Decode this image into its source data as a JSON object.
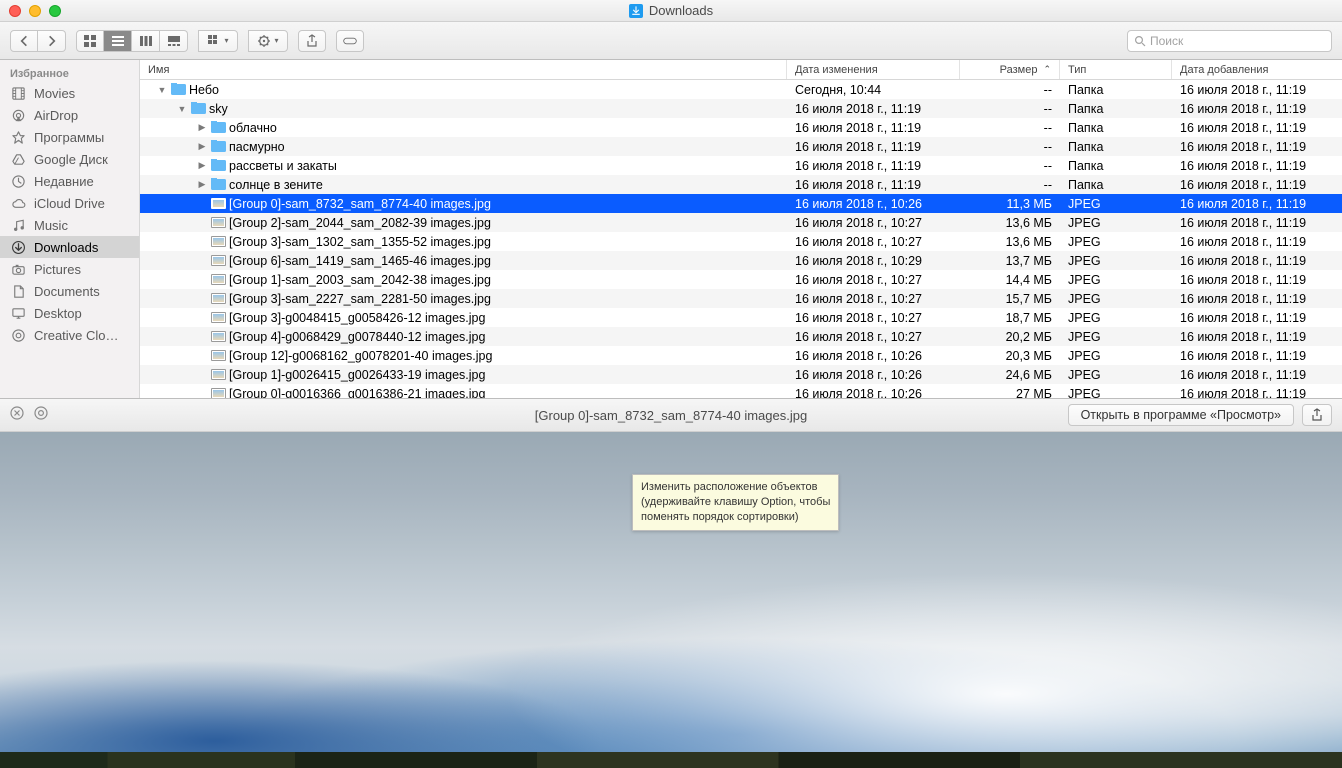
{
  "window": {
    "title": "Downloads"
  },
  "toolbar": {
    "search_placeholder": "Поиск"
  },
  "sidebar": {
    "header": "Избранное",
    "items": [
      {
        "label": "Movies",
        "icon": "film"
      },
      {
        "label": "AirDrop",
        "icon": "airdrop"
      },
      {
        "label": "Программы",
        "icon": "apps"
      },
      {
        "label": "Google Диск",
        "icon": "gdrive"
      },
      {
        "label": "Недавние",
        "icon": "clock"
      },
      {
        "label": "iCloud Drive",
        "icon": "cloud"
      },
      {
        "label": "Music",
        "icon": "music"
      },
      {
        "label": "Downloads",
        "icon": "download",
        "active": true
      },
      {
        "label": "Pictures",
        "icon": "camera"
      },
      {
        "label": "Documents",
        "icon": "doc"
      },
      {
        "label": "Desktop",
        "icon": "desktop"
      },
      {
        "label": "Creative Clo…",
        "icon": "cc"
      }
    ]
  },
  "columns": {
    "name": "Имя",
    "modified": "Дата изменения",
    "size": "Размер",
    "type": "Тип",
    "added": "Дата добавления"
  },
  "rows": [
    {
      "indent": 0,
      "disclosure": "down",
      "icon": "folder",
      "name": "Небо",
      "modified": "Сегодня, 10:44",
      "size": "--",
      "type": "Папка",
      "added": "16 июля 2018 г., 11:19"
    },
    {
      "indent": 1,
      "disclosure": "down",
      "icon": "folder",
      "name": "sky",
      "modified": "16 июля 2018 г., 11:19",
      "size": "--",
      "type": "Папка",
      "added": "16 июля 2018 г., 11:19"
    },
    {
      "indent": 2,
      "disclosure": "right",
      "icon": "folder",
      "name": "облачно",
      "modified": "16 июля 2018 г., 11:19",
      "size": "--",
      "type": "Папка",
      "added": "16 июля 2018 г., 11:19"
    },
    {
      "indent": 2,
      "disclosure": "right",
      "icon": "folder",
      "name": "пасмурно",
      "modified": "16 июля 2018 г., 11:19",
      "size": "--",
      "type": "Папка",
      "added": "16 июля 2018 г., 11:19"
    },
    {
      "indent": 2,
      "disclosure": "right",
      "icon": "folder",
      "name": "рассветы и закаты",
      "modified": "16 июля 2018 г., 11:19",
      "size": "--",
      "type": "Папка",
      "added": "16 июля 2018 г., 11:19"
    },
    {
      "indent": 2,
      "disclosure": "right",
      "icon": "folder",
      "name": "солнце в зените",
      "modified": "16 июля 2018 г., 11:19",
      "size": "--",
      "type": "Папка",
      "added": "16 июля 2018 г., 11:19"
    },
    {
      "indent": 2,
      "icon": "image",
      "name": "[Group 0]-sam_8732_sam_8774-40 images.jpg",
      "modified": "16 июля 2018 г., 10:26",
      "size": "11,3 МБ",
      "type": "JPEG",
      "added": "16 июля 2018 г., 11:19",
      "selected": true
    },
    {
      "indent": 2,
      "icon": "image",
      "name": "[Group 2]-sam_2044_sam_2082-39 images.jpg",
      "modified": "16 июля 2018 г., 10:27",
      "size": "13,6 МБ",
      "type": "JPEG",
      "added": "16 июля 2018 г., 11:19"
    },
    {
      "indent": 2,
      "icon": "image",
      "name": "[Group 3]-sam_1302_sam_1355-52 images.jpg",
      "modified": "16 июля 2018 г., 10:27",
      "size": "13,6 МБ",
      "type": "JPEG",
      "added": "16 июля 2018 г., 11:19"
    },
    {
      "indent": 2,
      "icon": "image",
      "name": "[Group 6]-sam_1419_sam_1465-46 images.jpg",
      "modified": "16 июля 2018 г., 10:29",
      "size": "13,7 МБ",
      "type": "JPEG",
      "added": "16 июля 2018 г., 11:19"
    },
    {
      "indent": 2,
      "icon": "image",
      "name": "[Group 1]-sam_2003_sam_2042-38 images.jpg",
      "modified": "16 июля 2018 г., 10:27",
      "size": "14,4 МБ",
      "type": "JPEG",
      "added": "16 июля 2018 г., 11:19"
    },
    {
      "indent": 2,
      "icon": "image",
      "name": "[Group 3]-sam_2227_sam_2281-50 images.jpg",
      "modified": "16 июля 2018 г., 10:27",
      "size": "15,7 МБ",
      "type": "JPEG",
      "added": "16 июля 2018 г., 11:19"
    },
    {
      "indent": 2,
      "icon": "image",
      "name": "[Group 3]-g0048415_g0058426-12 images.jpg",
      "modified": "16 июля 2018 г., 10:27",
      "size": "18,7 МБ",
      "type": "JPEG",
      "added": "16 июля 2018 г., 11:19"
    },
    {
      "indent": 2,
      "icon": "image",
      "name": "[Group 4]-g0068429_g0078440-12 images.jpg",
      "modified": "16 июля 2018 г., 10:27",
      "size": "20,2 МБ",
      "type": "JPEG",
      "added": "16 июля 2018 г., 11:19"
    },
    {
      "indent": 2,
      "icon": "image",
      "name": "[Group 12]-g0068162_g0078201-40 images.jpg",
      "modified": "16 июля 2018 г., 10:26",
      "size": "20,3 МБ",
      "type": "JPEG",
      "added": "16 июля 2018 г., 11:19"
    },
    {
      "indent": 2,
      "icon": "image",
      "name": "[Group 1]-g0026415_g0026433-19 images.jpg",
      "modified": "16 июля 2018 г., 10:26",
      "size": "24,6 МБ",
      "type": "JPEG",
      "added": "16 июля 2018 г., 11:19"
    },
    {
      "indent": 2,
      "icon": "image",
      "name": "[Group 0]-g0016366_g0016386-21 images.jpg",
      "modified": "16 июля 2018 г., 10:26",
      "size": "27 МБ",
      "type": "JPEG",
      "added": "16 июля 2018 г., 11:19"
    }
  ],
  "preview": {
    "title": "[Group 0]-sam_8732_sam_8774-40 images.jpg",
    "open_button": "Открыть в программе «Просмотр»"
  },
  "tooltip": {
    "line1": "Изменить расположение объектов",
    "line2": "(удерживайте клавишу Option, чтобы",
    "line3": "поменять порядок сортировки)"
  }
}
